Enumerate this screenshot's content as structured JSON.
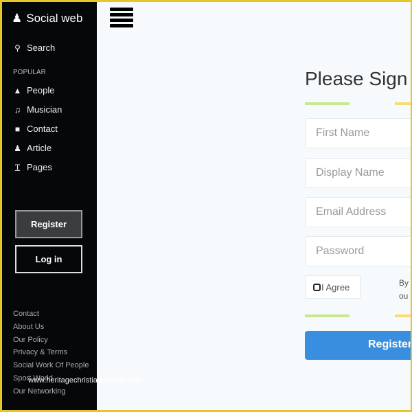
{
  "sidebar": {
    "brand": "Social web",
    "search": "Search",
    "section": "POPULAR",
    "items": [
      {
        "label": "People",
        "icon": "tree-icon"
      },
      {
        "label": "Musician",
        "icon": "music-icon"
      },
      {
        "label": "Contact",
        "icon": "video-icon"
      },
      {
        "label": "Article",
        "icon": "person-icon"
      },
      {
        "label": "Pages",
        "icon": "text-icon"
      }
    ],
    "register": "Register",
    "login": "Log in",
    "footer": [
      "Contact",
      "About Us",
      "Our Policy",
      "Privacy & Terms",
      "Social Work Of People",
      "Sport World",
      "Our Networking"
    ]
  },
  "watermark": "www.heritagechristiancollege.com",
  "form": {
    "title": "Please Sign",
    "first_name": "First Name",
    "display_name": "Display Name",
    "email": "Email Address",
    "password": "Password",
    "agree": "I Agree",
    "terms_line1": "By",
    "terms_line2": "ou",
    "submit": "Register"
  },
  "colors": {
    "accent": "#3a8ee0",
    "sidebar": "#050709",
    "frame": "#e8c52a",
    "divider_green": "#c8e88a",
    "divider_yellow": "#f8dc70"
  }
}
